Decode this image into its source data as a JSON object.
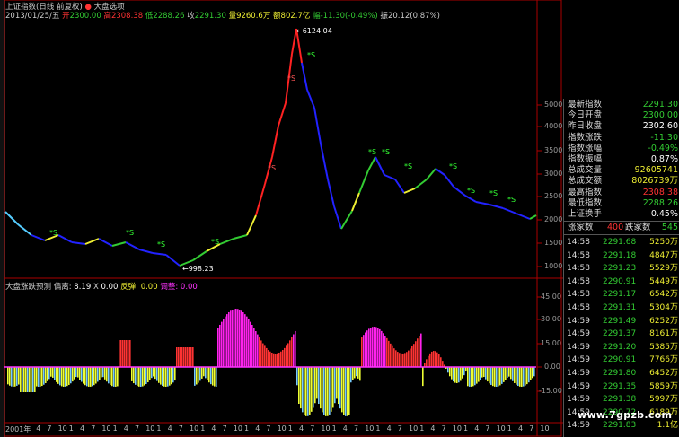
{
  "header": {
    "title": "上证指数(日线 前复权)",
    "indicator_name": "大盘选项",
    "date": "2013/01/25/五",
    "open_label": "开",
    "open_value": "2300.00",
    "high_label": "高",
    "high_value": "2308.38",
    "low_label": "低",
    "low_value": "2288.26",
    "close_label": "收",
    "close_value": "2291.30",
    "volume_label": "量",
    "volume_value": "9260.6万",
    "amount_label": "额",
    "amount_value": "802.7亿",
    "change_label": "幅",
    "change_value": "-11.30(-0.49%)",
    "amp_label": "振",
    "amp_value": "20.12(0.87%)"
  },
  "annotations": {
    "peak": "6124.04",
    "trough": "998.23"
  },
  "lower_indicator": {
    "name": "大盘涨跌预测",
    "offset_label": "偏离:",
    "offset_value": "8.19",
    "x_label": "X",
    "x_value": "0.00",
    "rebound_label": "反弹:",
    "rebound_value": "0.00",
    "adjust_label": "调整:",
    "adjust_value": "0.00"
  },
  "price_axis": [
    "5000",
    "4000",
    "3500",
    "3000",
    "2500",
    "2000",
    "1500",
    "1000"
  ],
  "ind_axis": [
    "45.00",
    "30.00",
    "15.00",
    "0.00",
    "-15.00"
  ],
  "x_axis": [
    "2001年",
    "4",
    "7",
    "10",
    "1",
    "4",
    "7",
    "10",
    "1",
    "4",
    "7",
    "10",
    "1",
    "4",
    "7",
    "10",
    "1",
    "4",
    "7",
    "10",
    "1",
    "4",
    "7",
    "10",
    "1",
    "4",
    "7",
    "10",
    "1",
    "4",
    "7",
    "10",
    "1",
    "4",
    "7",
    "10",
    "1",
    "4",
    "7",
    "10",
    "1",
    "4",
    "7",
    "10",
    "1",
    "4",
    "7",
    "10"
  ],
  "panel": {
    "rows": [
      {
        "k": "最新指数",
        "v": "2291.30",
        "c": "#3c3"
      },
      {
        "k": "今日开盘",
        "v": "2300.00",
        "c": "#3c3"
      },
      {
        "k": "昨日收盘",
        "v": "2302.60",
        "c": "#fff"
      },
      {
        "k": "指数涨跌",
        "v": "-11.30",
        "c": "#3c3"
      },
      {
        "k": "指数涨幅",
        "v": "-0.49%",
        "c": "#3c3"
      },
      {
        "k": "指数振幅",
        "v": "0.87%",
        "c": "#fff"
      },
      {
        "k": "总成交量",
        "v": "92605741",
        "c": "#ee3"
      },
      {
        "k": "总成交额",
        "v": "8026739万",
        "c": "#ee3"
      },
      {
        "k": "最高指数",
        "v": "2308.38",
        "c": "#f33"
      },
      {
        "k": "最低指数",
        "v": "2288.26",
        "c": "#3c3"
      },
      {
        "k": "上证换手",
        "v": "0.45%",
        "c": "#fff"
      }
    ],
    "rise_label": "涨家数",
    "rise_value": "400",
    "fall_label": "跌家数",
    "fall_value": "545",
    "ticks": [
      [
        "14:58",
        "2291.68",
        "5250万"
      ],
      [
        "14:58",
        "2291.18",
        "4847万"
      ],
      [
        "14:58",
        "2291.23",
        "5529万"
      ],
      [
        "14:58",
        "2290.91",
        "5449万"
      ],
      [
        "14:58",
        "2291.17",
        "6542万"
      ],
      [
        "14:58",
        "2291.31",
        "5304万"
      ],
      [
        "14:59",
        "2291.49",
        "6252万"
      ],
      [
        "14:59",
        "2291.37",
        "8161万"
      ],
      [
        "14:59",
        "2291.20",
        "5385万"
      ],
      [
        "14:59",
        "2290.91",
        "7766万"
      ],
      [
        "14:59",
        "2291.80",
        "6452万"
      ],
      [
        "14:59",
        "2291.35",
        "5859万"
      ],
      [
        "14:59",
        "2291.38",
        "5997万"
      ],
      [
        "14:59",
        "2290.72",
        "6189万"
      ],
      [
        "14:59",
        "2291.83",
        "1.1亿"
      ]
    ]
  },
  "watermark": "www.7gpzb.com"
}
